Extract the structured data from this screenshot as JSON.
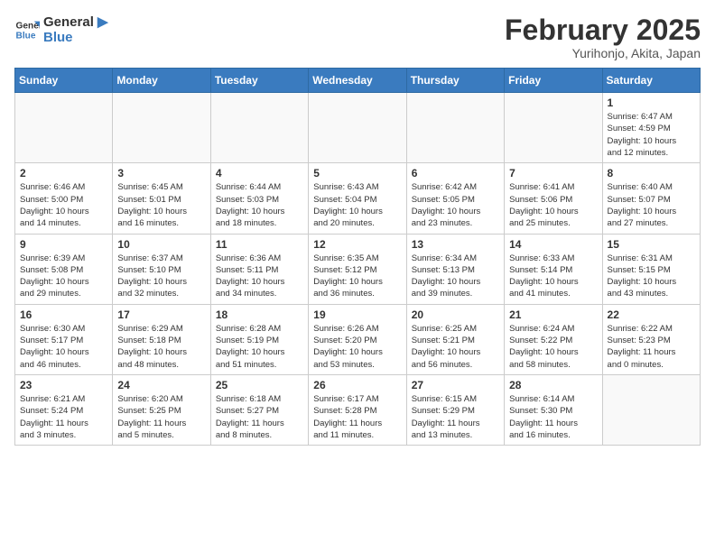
{
  "logo": {
    "line1": "General",
    "line2": "Blue"
  },
  "title": "February 2025",
  "subtitle": "Yurihonjo, Akita, Japan",
  "weekdays": [
    "Sunday",
    "Monday",
    "Tuesday",
    "Wednesday",
    "Thursday",
    "Friday",
    "Saturday"
  ],
  "weeks": [
    [
      {
        "day": "",
        "info": ""
      },
      {
        "day": "",
        "info": ""
      },
      {
        "day": "",
        "info": ""
      },
      {
        "day": "",
        "info": ""
      },
      {
        "day": "",
        "info": ""
      },
      {
        "day": "",
        "info": ""
      },
      {
        "day": "1",
        "info": "Sunrise: 6:47 AM\nSunset: 4:59 PM\nDaylight: 10 hours\nand 12 minutes."
      }
    ],
    [
      {
        "day": "2",
        "info": "Sunrise: 6:46 AM\nSunset: 5:00 PM\nDaylight: 10 hours\nand 14 minutes."
      },
      {
        "day": "3",
        "info": "Sunrise: 6:45 AM\nSunset: 5:01 PM\nDaylight: 10 hours\nand 16 minutes."
      },
      {
        "day": "4",
        "info": "Sunrise: 6:44 AM\nSunset: 5:03 PM\nDaylight: 10 hours\nand 18 minutes."
      },
      {
        "day": "5",
        "info": "Sunrise: 6:43 AM\nSunset: 5:04 PM\nDaylight: 10 hours\nand 20 minutes."
      },
      {
        "day": "6",
        "info": "Sunrise: 6:42 AM\nSunset: 5:05 PM\nDaylight: 10 hours\nand 23 minutes."
      },
      {
        "day": "7",
        "info": "Sunrise: 6:41 AM\nSunset: 5:06 PM\nDaylight: 10 hours\nand 25 minutes."
      },
      {
        "day": "8",
        "info": "Sunrise: 6:40 AM\nSunset: 5:07 PM\nDaylight: 10 hours\nand 27 minutes."
      }
    ],
    [
      {
        "day": "9",
        "info": "Sunrise: 6:39 AM\nSunset: 5:08 PM\nDaylight: 10 hours\nand 29 minutes."
      },
      {
        "day": "10",
        "info": "Sunrise: 6:37 AM\nSunset: 5:10 PM\nDaylight: 10 hours\nand 32 minutes."
      },
      {
        "day": "11",
        "info": "Sunrise: 6:36 AM\nSunset: 5:11 PM\nDaylight: 10 hours\nand 34 minutes."
      },
      {
        "day": "12",
        "info": "Sunrise: 6:35 AM\nSunset: 5:12 PM\nDaylight: 10 hours\nand 36 minutes."
      },
      {
        "day": "13",
        "info": "Sunrise: 6:34 AM\nSunset: 5:13 PM\nDaylight: 10 hours\nand 39 minutes."
      },
      {
        "day": "14",
        "info": "Sunrise: 6:33 AM\nSunset: 5:14 PM\nDaylight: 10 hours\nand 41 minutes."
      },
      {
        "day": "15",
        "info": "Sunrise: 6:31 AM\nSunset: 5:15 PM\nDaylight: 10 hours\nand 43 minutes."
      }
    ],
    [
      {
        "day": "16",
        "info": "Sunrise: 6:30 AM\nSunset: 5:17 PM\nDaylight: 10 hours\nand 46 minutes."
      },
      {
        "day": "17",
        "info": "Sunrise: 6:29 AM\nSunset: 5:18 PM\nDaylight: 10 hours\nand 48 minutes."
      },
      {
        "day": "18",
        "info": "Sunrise: 6:28 AM\nSunset: 5:19 PM\nDaylight: 10 hours\nand 51 minutes."
      },
      {
        "day": "19",
        "info": "Sunrise: 6:26 AM\nSunset: 5:20 PM\nDaylight: 10 hours\nand 53 minutes."
      },
      {
        "day": "20",
        "info": "Sunrise: 6:25 AM\nSunset: 5:21 PM\nDaylight: 10 hours\nand 56 minutes."
      },
      {
        "day": "21",
        "info": "Sunrise: 6:24 AM\nSunset: 5:22 PM\nDaylight: 10 hours\nand 58 minutes."
      },
      {
        "day": "22",
        "info": "Sunrise: 6:22 AM\nSunset: 5:23 PM\nDaylight: 11 hours\nand 0 minutes."
      }
    ],
    [
      {
        "day": "23",
        "info": "Sunrise: 6:21 AM\nSunset: 5:24 PM\nDaylight: 11 hours\nand 3 minutes."
      },
      {
        "day": "24",
        "info": "Sunrise: 6:20 AM\nSunset: 5:25 PM\nDaylight: 11 hours\nand 5 minutes."
      },
      {
        "day": "25",
        "info": "Sunrise: 6:18 AM\nSunset: 5:27 PM\nDaylight: 11 hours\nand 8 minutes."
      },
      {
        "day": "26",
        "info": "Sunrise: 6:17 AM\nSunset: 5:28 PM\nDaylight: 11 hours\nand 11 minutes."
      },
      {
        "day": "27",
        "info": "Sunrise: 6:15 AM\nSunset: 5:29 PM\nDaylight: 11 hours\nand 13 minutes."
      },
      {
        "day": "28",
        "info": "Sunrise: 6:14 AM\nSunset: 5:30 PM\nDaylight: 11 hours\nand 16 minutes."
      },
      {
        "day": "",
        "info": ""
      }
    ]
  ]
}
